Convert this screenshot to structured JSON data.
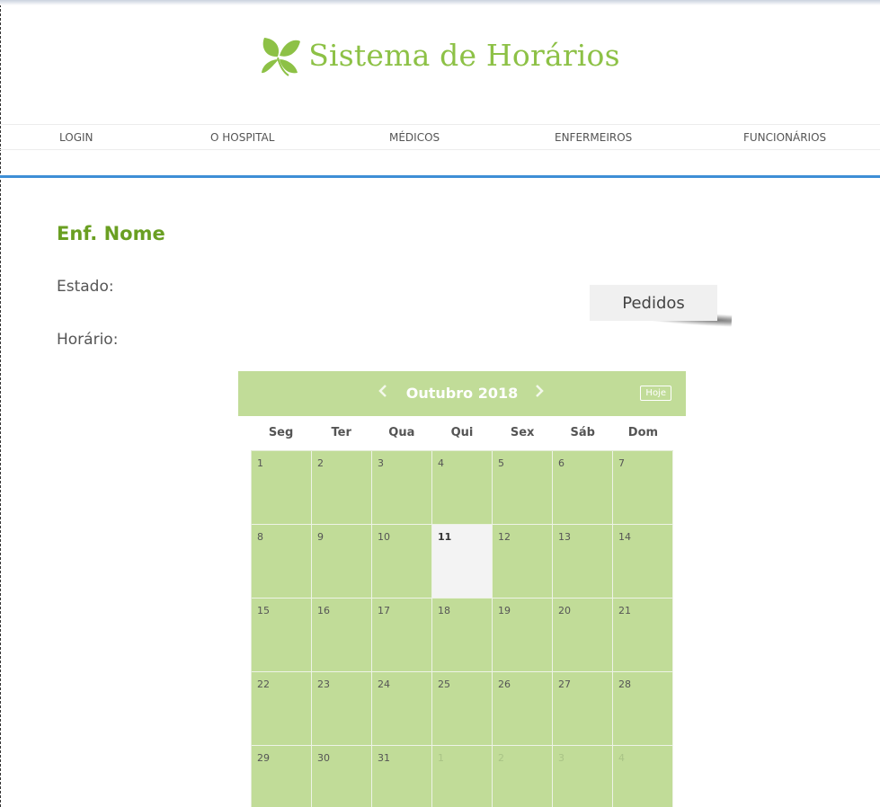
{
  "brand": {
    "title": "Sistema de Horários",
    "logo_icon": "leaf-icon",
    "color": "#8dc146"
  },
  "nav": [
    {
      "label": "LOGIN"
    },
    {
      "label": "O HOSPITAL"
    },
    {
      "label": "MÉDICOS"
    },
    {
      "label": "ENFERMEIROS"
    },
    {
      "label": "FUNCIONÁRIOS"
    }
  ],
  "page": {
    "title": "Enf. Nome",
    "estado_label": "Estado:",
    "horario_label": "Horário:"
  },
  "pedidos_button": "Pedidos",
  "calendar": {
    "title": "Outubro 2018",
    "today_button": "Hoje",
    "prev_icon": "chevron-left-icon",
    "next_icon": "chevron-right-icon",
    "accent": "#c1dc98",
    "weekdays": [
      "Seg",
      "Ter",
      "Qua",
      "Qui",
      "Sex",
      "Sáb",
      "Dom"
    ],
    "days": [
      {
        "n": "1"
      },
      {
        "n": "2"
      },
      {
        "n": "3"
      },
      {
        "n": "4"
      },
      {
        "n": "5"
      },
      {
        "n": "6"
      },
      {
        "n": "7"
      },
      {
        "n": "8"
      },
      {
        "n": "9"
      },
      {
        "n": "10"
      },
      {
        "n": "11",
        "today": true
      },
      {
        "n": "12"
      },
      {
        "n": "13"
      },
      {
        "n": "14"
      },
      {
        "n": "15"
      },
      {
        "n": "16"
      },
      {
        "n": "17"
      },
      {
        "n": "18"
      },
      {
        "n": "19"
      },
      {
        "n": "20"
      },
      {
        "n": "21"
      },
      {
        "n": "22"
      },
      {
        "n": "23"
      },
      {
        "n": "24"
      },
      {
        "n": "25"
      },
      {
        "n": "26"
      },
      {
        "n": "27"
      },
      {
        "n": "28"
      },
      {
        "n": "29"
      },
      {
        "n": "30"
      },
      {
        "n": "31"
      },
      {
        "n": "1",
        "other": true
      },
      {
        "n": "2",
        "other": true
      },
      {
        "n": "3",
        "other": true
      },
      {
        "n": "4",
        "other": true
      }
    ]
  }
}
